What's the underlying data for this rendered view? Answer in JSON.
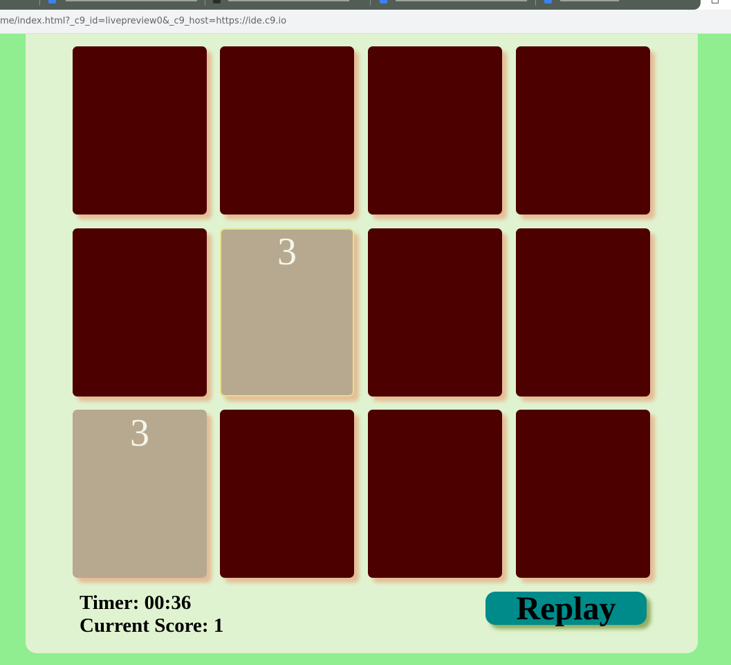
{
  "browser": {
    "url": "me/index.html?_c9_id=livepreview0&_c9_host=https://ide.c9.io"
  },
  "game": {
    "cards": [
      {
        "state": "face-down",
        "value": ""
      },
      {
        "state": "face-down",
        "value": ""
      },
      {
        "state": "face-down",
        "value": ""
      },
      {
        "state": "face-down",
        "value": ""
      },
      {
        "state": "face-down",
        "value": ""
      },
      {
        "state": "face-up",
        "value": "3",
        "selected": true
      },
      {
        "state": "face-down",
        "value": ""
      },
      {
        "state": "face-down",
        "value": ""
      },
      {
        "state": "face-up",
        "value": "3",
        "selected": false
      },
      {
        "state": "face-down",
        "value": ""
      },
      {
        "state": "face-down",
        "value": ""
      },
      {
        "state": "face-down",
        "value": ""
      }
    ],
    "timer_text": "Timer: 00:36",
    "score_text": "Current Score: 1",
    "replay_label": "Replay"
  },
  "colors": {
    "page_background": "#90ee90",
    "panel_background": "#e0f3d0",
    "card_back": "#4d0000",
    "card_face": "#b7a990",
    "card_number": "#f4f6e8",
    "replay_button": "#008b8b"
  }
}
